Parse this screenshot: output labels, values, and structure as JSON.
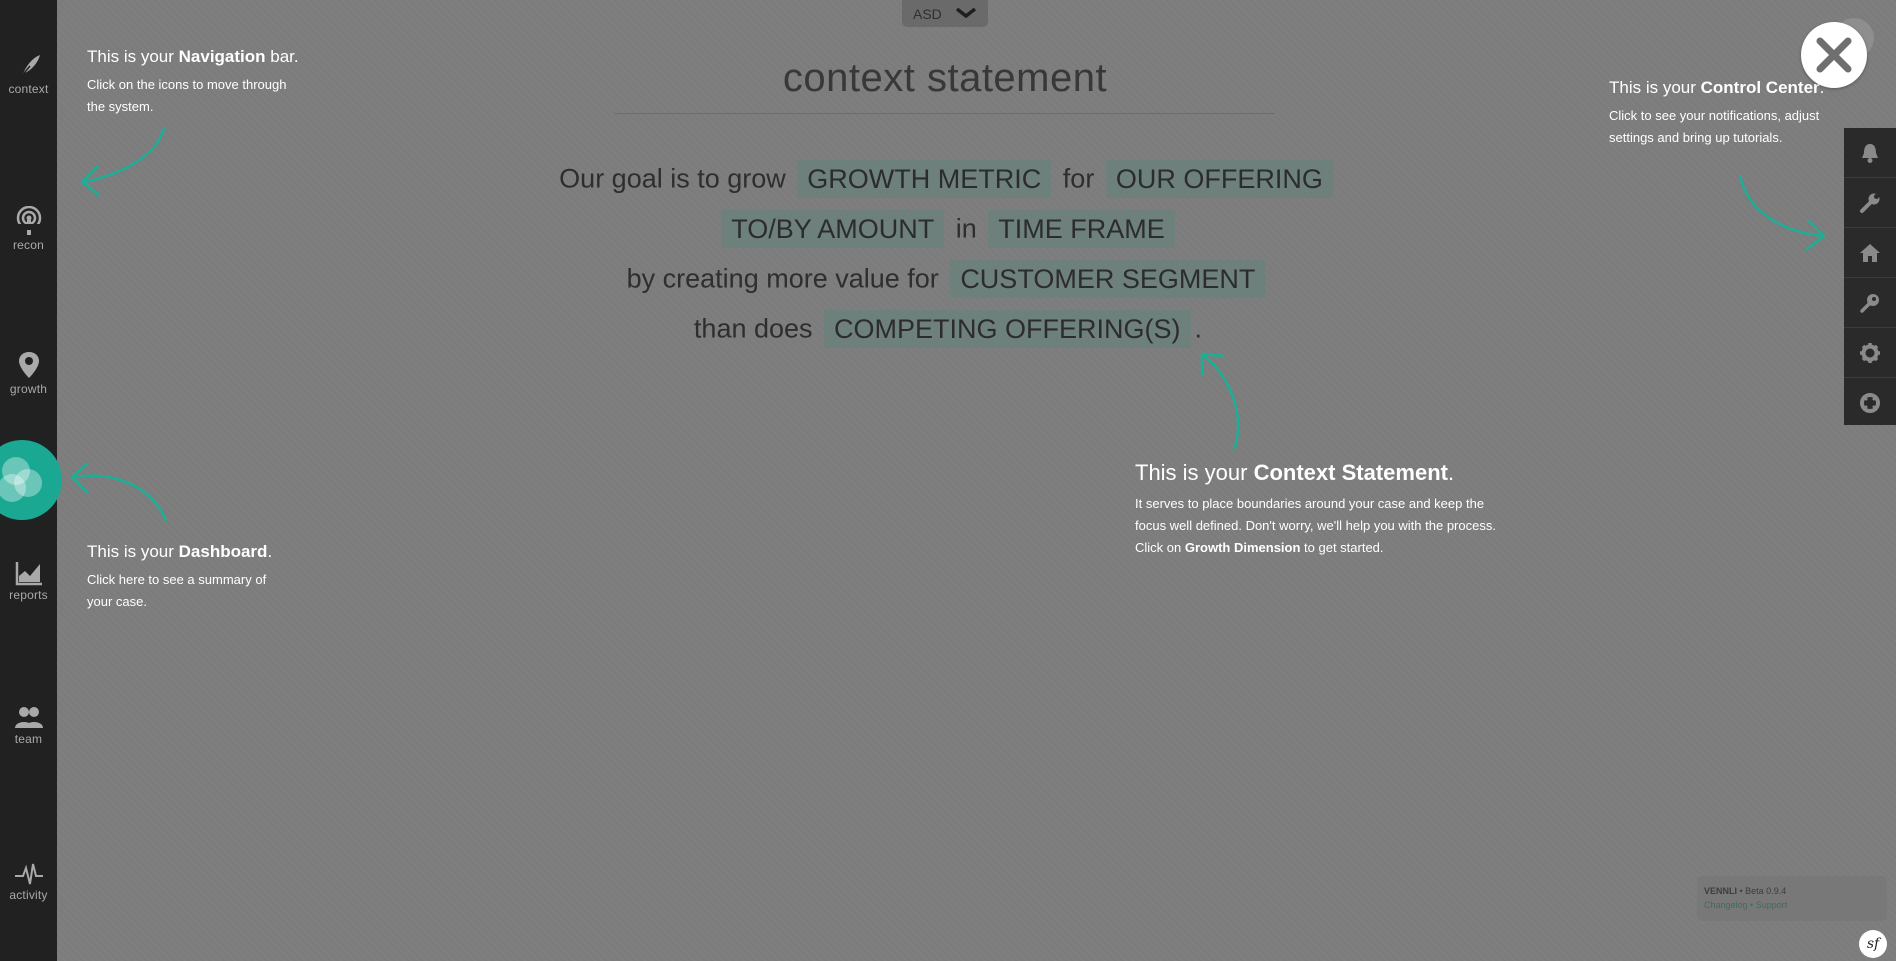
{
  "case_selector": {
    "value": "ASD"
  },
  "page": {
    "title": "context statement"
  },
  "statement": {
    "line1": {
      "prefix": "Our goal is to grow",
      "chip1": "GROWTH METRIC",
      "mid": "for",
      "chip2": "OUR OFFERING"
    },
    "line2": {
      "chip1": "TO/BY AMOUNT",
      "mid": "in",
      "chip2": "TIME FRAME"
    },
    "line3": {
      "prefix": "by creating more value for",
      "chip1": "CUSTOMER SEGMENT"
    },
    "line4": {
      "prefix": "than does",
      "chip1": "COMPETING OFFERING(S)",
      "suffix": "."
    }
  },
  "nav": {
    "items": [
      {
        "label": "context",
        "icon": "quill-icon"
      },
      {
        "label": "recon",
        "icon": "broadcast-icon"
      },
      {
        "label": "growth",
        "icon": "map-pin-icon"
      },
      {
        "label": "reports",
        "icon": "chart-icon"
      },
      {
        "label": "team",
        "icon": "people-icon"
      },
      {
        "label": "activity",
        "icon": "pulse-icon"
      }
    ],
    "dashboard_icon": "venn-icon"
  },
  "control_center": {
    "icons": [
      "bell-icon",
      "wrench-icon",
      "home-icon",
      "key-icon",
      "gear-icon",
      "lifebuoy-icon"
    ]
  },
  "callouts": {
    "nav": {
      "head_pre": "This is your ",
      "head_bold": "Navigation",
      "head_post": " bar.",
      "body": "Click on the icons to move through the system."
    },
    "dashboard": {
      "head_pre": "This is your ",
      "head_bold": "Dashboard",
      "head_post": ".",
      "body": "Click here to see a summary of your case."
    },
    "control": {
      "head_pre": "This is your ",
      "head_bold": "Control Center",
      "head_post": ".",
      "body": "Click to see your notifications, adjust settings and bring up tutorials."
    },
    "context": {
      "head_pre": "This is your ",
      "head_bold": "Context Statement",
      "head_post": ".",
      "body_pre": "It serves to place boundaries around your case and keep the focus well defined. Don't worry, we'll help you with the process. Click on ",
      "body_bold": "Growth Dimension",
      "body_post": " to get started."
    }
  },
  "version": {
    "brand": "VENNLI",
    "sep": " • ",
    "beta": "Beta 0.9.4",
    "changelog": "Changelog",
    "dot": " • ",
    "support": "Support"
  },
  "badge": {
    "text": "sf"
  },
  "colors": {
    "accent": "#1aa892",
    "chip": "#6d807c",
    "nav_bg": "#212121"
  }
}
